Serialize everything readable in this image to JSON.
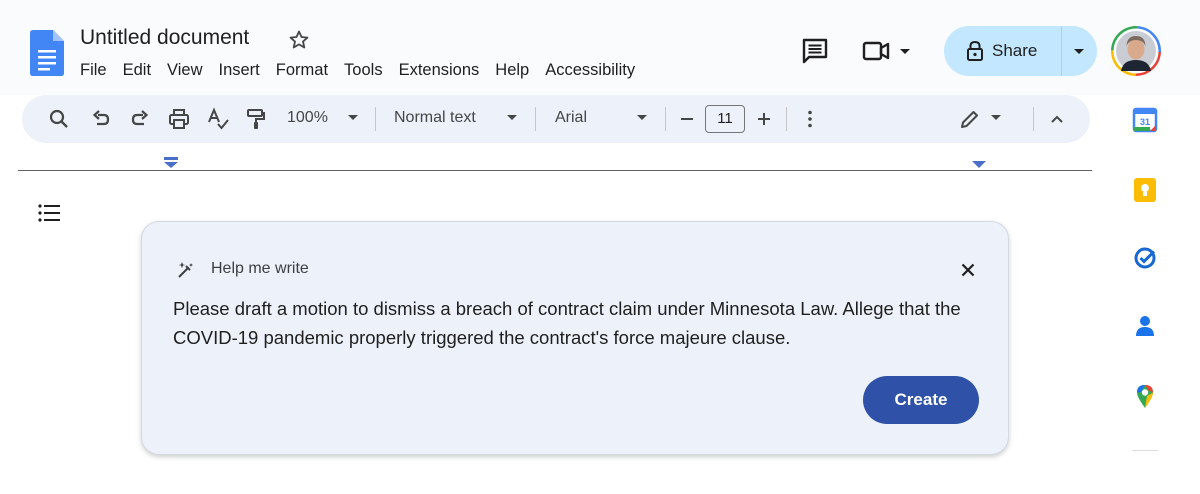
{
  "header": {
    "doc_title": "Untitled document",
    "menu": [
      "File",
      "Edit",
      "View",
      "Insert",
      "Format",
      "Tools",
      "Extensions",
      "Help",
      "Accessibility"
    ],
    "share_label": "Share",
    "icons": [
      "docs-logo-icon",
      "star-icon",
      "comment-icon",
      "video-call-icon",
      "lock-icon",
      "avatar"
    ]
  },
  "toolbar": {
    "zoom": "100%",
    "style": "Normal text",
    "font": "Arial",
    "font_size": "11",
    "icons": [
      "search-icon",
      "undo-icon",
      "redo-icon",
      "print-icon",
      "spellcheck-icon",
      "paint-format-icon",
      "more-vert-icon",
      "edit-mode-icon",
      "collapse-icon"
    ]
  },
  "side_panel": {
    "icons": [
      "calendar-icon",
      "keep-icon",
      "tasks-icon",
      "contacts-icon",
      "maps-icon"
    ],
    "calendar_day": "31"
  },
  "help_me_write": {
    "title": "Help me write",
    "prompt": "Please draft a motion to dismiss a breach of contract claim under Minnesota Law. Allege that the COVID-19 pandemic properly triggered the contract's force majeure clause.",
    "create_label": "Create"
  },
  "colors": {
    "accent": "#2f52a8",
    "share_bg": "#c2e7ff",
    "toolbar_bg": "#edf2fa",
    "card_bg": "#edf1f9"
  }
}
